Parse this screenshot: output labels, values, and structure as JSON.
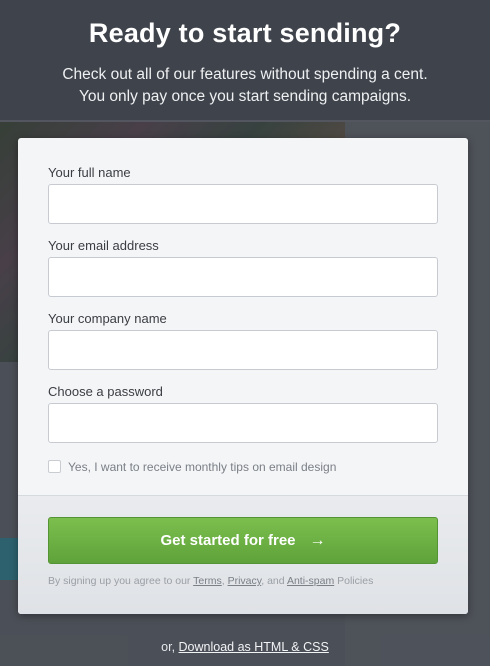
{
  "header": {
    "title": "Ready to start sending?",
    "subtitle_line1": "Check out all of our features without spending a cent.",
    "subtitle_line2": "You only pay once you start sending campaigns."
  },
  "form": {
    "full_name_label": "Your full name",
    "full_name_value": "",
    "email_label": "Your email address",
    "email_value": "",
    "company_label": "Your company name",
    "company_value": "",
    "password_label": "Choose a password",
    "password_value": "",
    "tips_checkbox_label": "Yes, I want to receive monthly tips on email design",
    "tips_checked": false
  },
  "footer": {
    "cta_label": "Get started for free",
    "cta_arrow": "→",
    "legal_prefix": "By signing up you agree to our ",
    "terms_link": "Terms",
    "sep1": ", ",
    "privacy_link": "Privacy",
    "sep2": ", and ",
    "antispam_link": "Anti-spam",
    "legal_suffix": " Policies"
  },
  "bottom": {
    "prefix": "or, ",
    "download_link": "Download as HTML & CSS"
  },
  "colors": {
    "cta_green": "#6ab244",
    "overlay": "#5b5f66",
    "card_bg": "#f4f5f7"
  }
}
